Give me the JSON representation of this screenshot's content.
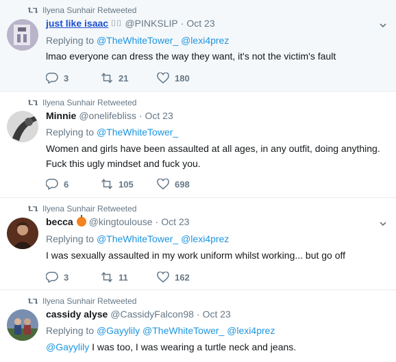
{
  "tweets": [
    {
      "retweeted_by": "Ilyena Sunhair Retweeted",
      "name": "just like isaac",
      "name_suffix": "⌷⌷",
      "handle": "@PINKSLIP",
      "time": "Oct 23",
      "replying_to_label": "Replying to",
      "replying_to": [
        "@TheWhiteTower_",
        "@lexi4prez"
      ],
      "text": "lmao everyone can dress the way they want, it's not the victim's fault",
      "replies": "3",
      "retweets": "21",
      "likes": "180"
    },
    {
      "retweeted_by": "Ilyena Sunhair Retweeted",
      "name": "Minnie",
      "handle": "@onelifebliss",
      "time": "Oct 23",
      "replying_to_label": "Replying to",
      "replying_to": [
        "@TheWhiteTower_"
      ],
      "text": "Women and girls have been assaulted at all ages, in any outfit, doing anything. Fuck this ugly mindset and fuck you.",
      "replies": "6",
      "retweets": "105",
      "likes": "698"
    },
    {
      "retweeted_by": "Ilyena Sunhair Retweeted",
      "name": "becca",
      "handle": "@kingtoulouse",
      "time": "Oct 23",
      "replying_to_label": "Replying to",
      "replying_to": [
        "@TheWhiteTower_",
        "@lexi4prez"
      ],
      "text": "I was sexually assaulted in my work uniform whilst working... but go off",
      "replies": "3",
      "retweets": "11",
      "likes": "162"
    },
    {
      "retweeted_by": "Ilyena Sunhair Retweeted",
      "name": "cassidy alyse",
      "handle": "@CassidyFalcon98",
      "time": "Oct 23",
      "replying_to_label": "Replying to",
      "replying_to": [
        "@Gayylily",
        "@TheWhiteTower_",
        "@lexi4prez"
      ],
      "text_mention": "@Gayylily",
      "text": " I was too, I was wearing a turtle neck and jeans."
    }
  ],
  "colors": {
    "mention": "#1b95e0",
    "secondary_text": "#657786",
    "highlight_bg": "#f5f8fa",
    "link_name": "#1b4fd1"
  }
}
